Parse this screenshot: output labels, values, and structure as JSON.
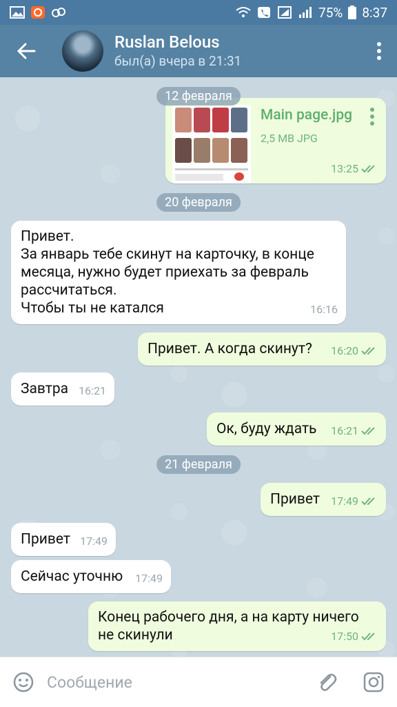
{
  "statusbar": {
    "battery": "75%",
    "time": "8:37"
  },
  "header": {
    "name": "Ruslan Belous",
    "status": "был(а) вчера в 21:31"
  },
  "messages": {
    "d1": "12 февраля",
    "file": {
      "name": "Main page.jpg",
      "meta": "2,5 MB JPG",
      "time": "13:25"
    },
    "d2": "20 февраля",
    "m1": {
      "lines": [
        "Привет.",
        "За январь тебе скинут на карточку,  в конце",
        "месяца, нужно будет приехать за февраль",
        "рассчитаться.",
        "Чтобы ты не катался"
      ],
      "time": "16:16"
    },
    "m2": {
      "text": "Привет. А когда скинут?",
      "time": "16:20"
    },
    "m3": {
      "text": "Завтра",
      "time": "16:21"
    },
    "m4": {
      "text": "Ок, буду ждать",
      "time": "16:21"
    },
    "d3": "21 февраля",
    "m5": {
      "text": "Привет",
      "time": "17:49"
    },
    "m6": {
      "text": "Привет",
      "time": "17:49"
    },
    "m7": {
      "text": "Сейчас уточню",
      "time": "17:49"
    },
    "m8": {
      "lines": [
        "Конец рабочего дня, а на карту ничего",
        "не скинули"
      ],
      "time": "17:50"
    }
  },
  "input": {
    "placeholder": "Сообщение"
  },
  "colors": {
    "header": "#5682a3",
    "outgoing": "#effdde",
    "incoming": "#ffffff",
    "accent": "#5fae6f"
  }
}
